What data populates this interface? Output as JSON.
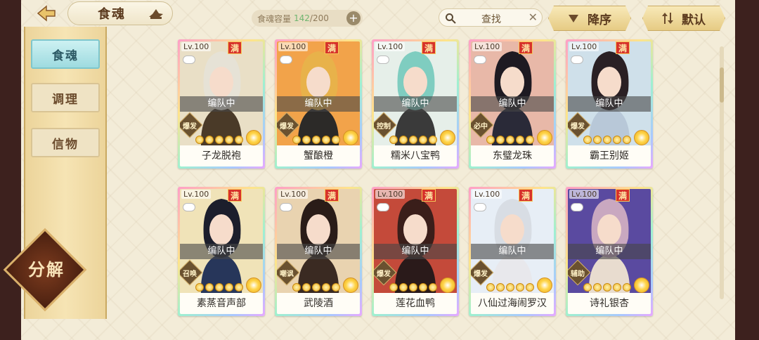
{
  "header": {
    "title": "食魂",
    "capacity_label": "食魂容量",
    "capacity_current": "142",
    "capacity_max": "/200",
    "plus": "+",
    "search_label": "查找",
    "search_clear": "✕",
    "sort_label": "降序",
    "default_label": "默认"
  },
  "sidebar": {
    "tabs": [
      {
        "label": "食魂",
        "active": true
      },
      {
        "label": "调理",
        "active": false
      },
      {
        "label": "信物",
        "active": false
      }
    ],
    "decompose_label": "分解"
  },
  "cards": [
    {
      "level": "Lv.100",
      "badge": "满",
      "status": "编队中",
      "role": "爆发",
      "name": "子龙脱袍",
      "bg": "#e9dfc6",
      "hair": "#e6e2d6",
      "outfit": "#4a3a28"
    },
    {
      "level": "Lv.100",
      "badge": "满",
      "status": "编队中",
      "role": "爆发",
      "name": "蟹酿橙",
      "bg": "#f2a34a",
      "hair": "#e8b24a",
      "outfit": "#2c2a28"
    },
    {
      "level": "Lv.100",
      "badge": "满",
      "status": "编队中",
      "role": "控制",
      "name": "糯米八宝鸭",
      "bg": "#e6efe9",
      "hair": "#7fcdc0",
      "outfit": "#3a3a3a"
    },
    {
      "level": "Lv.100",
      "badge": "满",
      "status": "编队中",
      "role": "必中",
      "name": "东璧龙珠",
      "bg": "#e8b8a8",
      "hair": "#1e1a22",
      "outfit": "#2a2a38"
    },
    {
      "level": "Lv.100",
      "badge": "满",
      "status": "编队中",
      "role": "爆发",
      "name": "霸王别姬",
      "bg": "#cfe0ea",
      "hair": "#2a2024",
      "outfit": "#b8c8d8"
    },
    {
      "level": "Lv.100",
      "badge": "满",
      "status": "编队中",
      "role": "召唤",
      "name": "素蒸音声部",
      "bg": "#f0e3b8",
      "hair": "#1c1e2c",
      "outfit": "#27365a"
    },
    {
      "level": "Lv.100",
      "badge": "满",
      "status": "编队中",
      "role": "嘲讽",
      "name": "武陵酒",
      "bg": "#e9d3b0",
      "hair": "#2a1c18",
      "outfit": "#3a2a22"
    },
    {
      "level": "Lv.100",
      "badge": "满",
      "status": "编队中",
      "role": "爆发",
      "name": "莲花血鸭",
      "bg": "#c44a3a",
      "hair": "#3a1e1a",
      "outfit": "#2a1a1a"
    },
    {
      "level": "Lv.100",
      "badge": "满",
      "status": "编队中",
      "role": "爆发",
      "name": "八仙过海闹罗汉",
      "bg": "#e7eef6",
      "hair": "#d8dde4",
      "outfit": "#e8e8ec"
    },
    {
      "level": "Lv.100",
      "badge": "满",
      "status": "编队中",
      "role": "辅助",
      "name": "诗礼银杏",
      "bg": "#5a4aa0",
      "hair": "#c9a8c0",
      "outfit": "#e8dccf"
    }
  ]
}
